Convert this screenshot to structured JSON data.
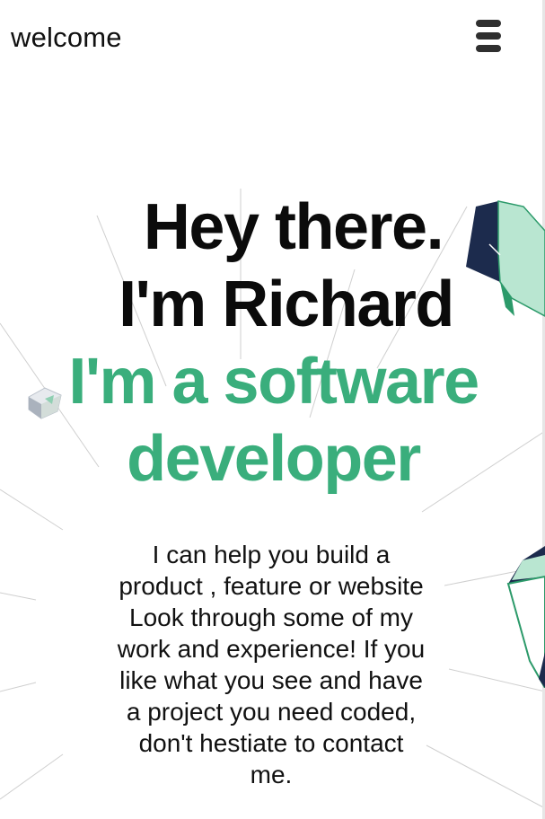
{
  "header": {
    "brand": "welcome",
    "menu_icon": "hamburger-menu-icon"
  },
  "hero": {
    "line1": "Hey there.",
    "line2": "I'm Richard",
    "line3": "I'm a software",
    "line4": "developer"
  },
  "intro": {
    "text": "I can help you build a product , feature or website Look through some of my work and experience! If you like what you see and have a project you need coded, don't hestiate to contact me."
  },
  "colors": {
    "accent": "#3aae7c",
    "heading": "#0b0b0b",
    "navy": "#1c2b4d",
    "mint": "#b9e6d1"
  }
}
